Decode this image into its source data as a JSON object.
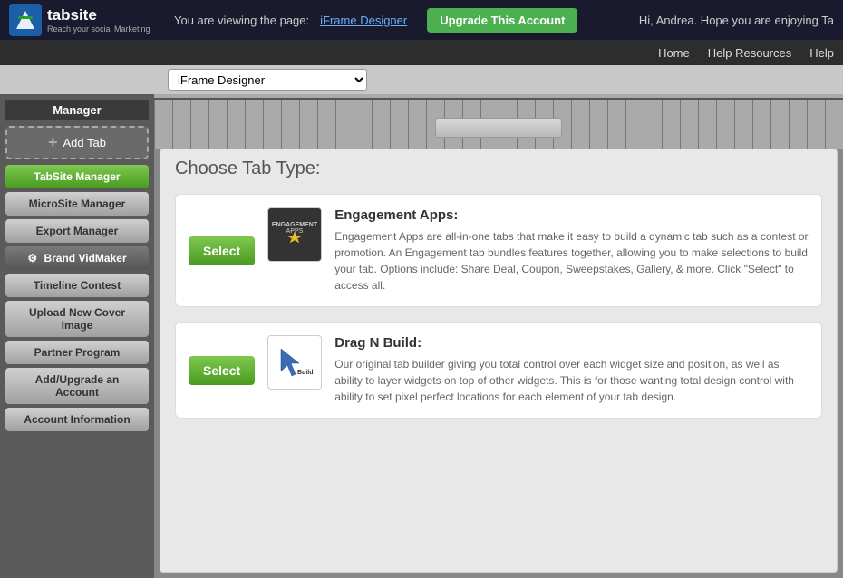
{
  "header": {
    "logo_letter": "t",
    "logo_name": "tabsite",
    "logo_tagline": "Reach your social Marketing",
    "viewing_label": "You are viewing the page:",
    "page_link": "iFrame Designer",
    "upgrade_button": "Upgrade This Account",
    "greeting": "Hi, Andrea. Hope you are enjoying Ta"
  },
  "nav": {
    "items": [
      "Home",
      "Help Resources",
      "Help"
    ]
  },
  "dropdown": {
    "current": "iFrame Designer",
    "placeholder": "iFrame Designer"
  },
  "sidebar": {
    "manager": "Manager",
    "add_tab": "Add Tab",
    "items": [
      {
        "label": "TabSite Manager",
        "style": "active"
      },
      {
        "label": "MicroSite Manager",
        "style": "gray"
      },
      {
        "label": "Export Manager",
        "style": "gray"
      },
      {
        "label": "Brand VidMaker",
        "style": "dark"
      },
      {
        "label": "Timeline Contest",
        "style": "gray"
      },
      {
        "label": "Upload New Cover Image",
        "style": "gray"
      },
      {
        "label": "Partner Program",
        "style": "gray"
      },
      {
        "label": "Add/Upgrade an Account",
        "style": "gray"
      },
      {
        "label": "Account Information",
        "style": "gray"
      }
    ]
  },
  "tab_type": {
    "title": "Choose Tab Type:",
    "cards": [
      {
        "title": "Engagement Apps:",
        "select_label": "Select",
        "description": "Engagement Apps are all-in-one tabs that make it easy to build a dynamic tab such as a contest or promotion. An Engagement tab bundles features together, allowing you to make selections to build your tab. Options include: Share Deal, Coupon, Sweepstakes, Gallery, & more. Click \"Select\" to access all.",
        "icon_type": "engagement"
      },
      {
        "title": "Drag N Build:",
        "select_label": "Select",
        "description": "Our original tab builder giving you total control over each widget size and position, as well as ability to layer widgets on top of other widgets. This is for those wanting total design control with ability to set pixel perfect locations for each element of your tab design.",
        "icon_type": "dragbuild"
      }
    ]
  }
}
